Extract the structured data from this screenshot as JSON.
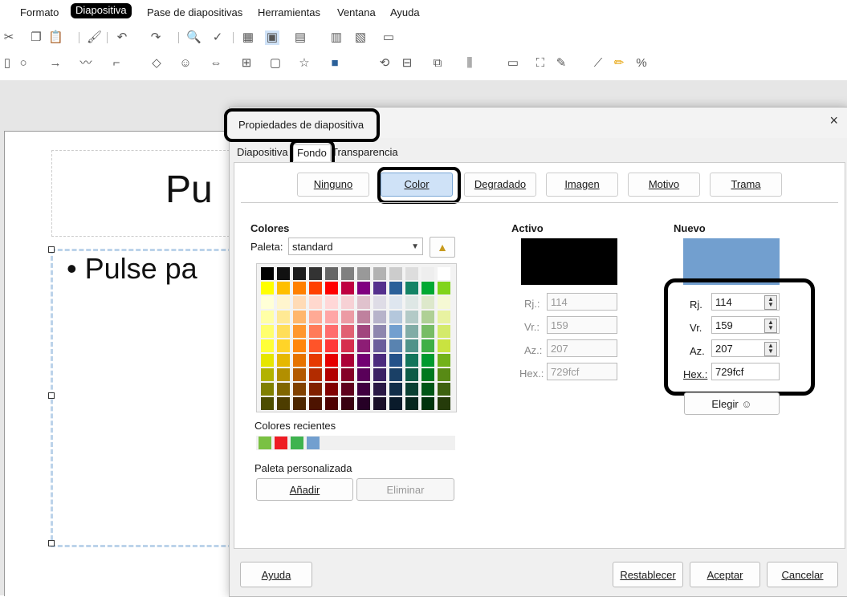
{
  "menubar": {
    "items": [
      "Formato",
      "Diapositiva",
      "Pase de diapositivas",
      "Herramientas",
      "Ventana",
      "Ayuda"
    ],
    "highlighted": "Diapositiva"
  },
  "slide": {
    "title_text": "Pu",
    "body_text": "• Pulse pa"
  },
  "dialog": {
    "title": "Propiedades de diapositiva",
    "close_glyph": "×",
    "tabs": [
      "Diapositiva",
      "Fondo",
      "Transparencia"
    ],
    "active_tab": "Fondo",
    "type_buttons": [
      "Ninguno",
      "Color",
      "Degradado",
      "Imagen",
      "Motivo",
      "Trama"
    ],
    "active_type": "Color",
    "colors_heading": "Colores",
    "palette_label": "Paleta:",
    "palette_value": "standard",
    "recent_label": "Colores recientes",
    "recent_colors": [
      "#7ac143",
      "#ee1c24",
      "#3fb34f",
      "#729fcf"
    ],
    "custom_palette_label": "Paleta personalizada",
    "add_button": "Añadir",
    "delete_button": "Eliminar",
    "active": {
      "heading": "Activo",
      "color": "#000000",
      "r_label": "Rj.:",
      "r": "114",
      "g_label": "Vr.:",
      "g": "159",
      "b_label": "Az.:",
      "b": "207",
      "hex_label": "Hex.:",
      "hex": "729fcf"
    },
    "new": {
      "heading": "Nuevo",
      "color": "#729fcf",
      "r_label": "Rj.",
      "r": "114",
      "g_label": "Vr.",
      "g": "159",
      "b_label": "Az.",
      "b": "207",
      "hex_label": "Hex.:",
      "hex": "729fcf",
      "choose_button": "Elegir"
    },
    "footer": {
      "help": "Ayuda",
      "reset": "Restablecer",
      "ok": "Aceptar",
      "cancel": "Cancelar"
    }
  },
  "palette_grid": [
    [
      "#000000",
      "#111111",
      "#1c1c1c",
      "#333333",
      "#666666",
      "#808080",
      "#999999",
      "#b2b2b2",
      "#cccccc",
      "#dddddd",
      "#eeeeee",
      "#ffffff"
    ],
    [
      "#ffff00",
      "#ffbf00",
      "#ff8000",
      "#ff4000",
      "#ff0000",
      "#bf0041",
      "#800080",
      "#55308d",
      "#2a6099",
      "#158466",
      "#00a933",
      "#81d41a"
    ],
    [
      "#ffffd7",
      "#fff5ce",
      "#ffdbb6",
      "#ffd8ce",
      "#ffd7d7",
      "#f7d1d5",
      "#e0c2cd",
      "#dedce6",
      "#dee6ef",
      "#dee7e5",
      "#dde8cb",
      "#f6f9d4"
    ],
    [
      "#ffffa6",
      "#ffe994",
      "#ffb66c",
      "#ffaa95",
      "#ffa6a6",
      "#ec9ba4",
      "#bf819e",
      "#b7b3ca",
      "#b4c7dc",
      "#b3cac7",
      "#afd095",
      "#e8f2a1"
    ],
    [
      "#ffff6d",
      "#ffde59",
      "#ff972f",
      "#ff7b59",
      "#ff6d6d",
      "#e16173",
      "#a1467e",
      "#8e86ae",
      "#729fcf",
      "#81aca6",
      "#77bc65",
      "#d4ea6b"
    ],
    [
      "#ffff38",
      "#ffd428",
      "#ff860d",
      "#ff5429",
      "#ff3838",
      "#d62e4e",
      "#8d1d75",
      "#6b5e9b",
      "#5983b0",
      "#50938a",
      "#3faf46",
      "#c9e340"
    ],
    [
      "#e6e600",
      "#e6b800",
      "#e67300",
      "#e63900",
      "#e60000",
      "#ac0037",
      "#730073",
      "#4c2b7d",
      "#245289",
      "#13755b",
      "#009a2e",
      "#72b21a"
    ],
    [
      "#b2b200",
      "#b28f00",
      "#b25900",
      "#b22c00",
      "#b20000",
      "#850027",
      "#590059",
      "#3b2163",
      "#1a4066",
      "#0e5b47",
      "#00781f",
      "#588a15"
    ],
    [
      "#808000",
      "#806600",
      "#804000",
      "#802000",
      "#800000",
      "#5f001c",
      "#400040",
      "#2a1845",
      "#112e49",
      "#0a4033",
      "#005616",
      "#3e6210"
    ],
    [
      "#4d4d00",
      "#4d3d00",
      "#4d2600",
      "#4d1300",
      "#4d0000",
      "#390010",
      "#260026",
      "#1a0f29",
      "#0a1b2b",
      "#06261e",
      "#00330c",
      "#253b0a"
    ]
  ]
}
